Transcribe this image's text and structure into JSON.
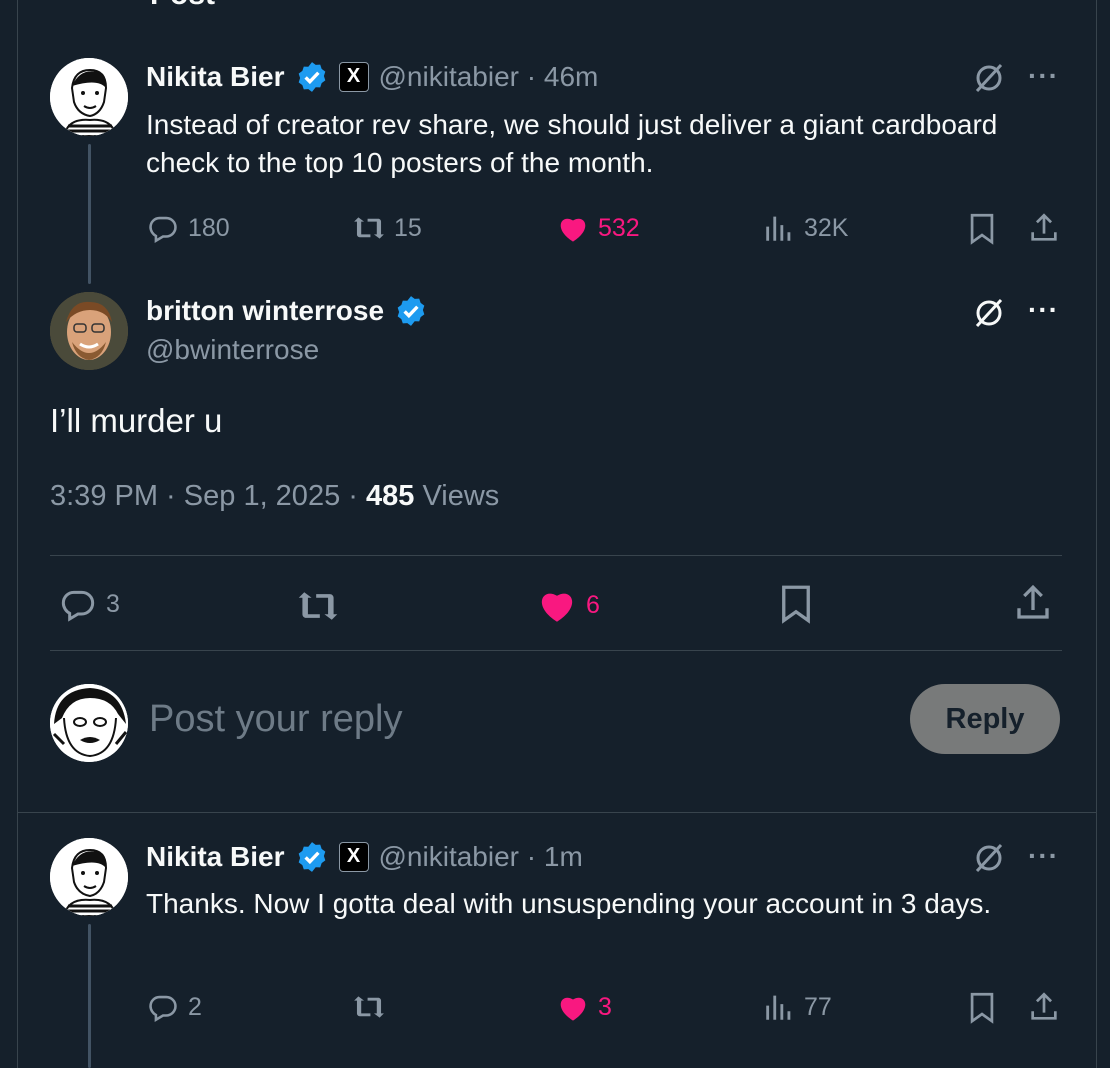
{
  "top_partial_text": "Post",
  "tweet1": {
    "name": "Nikita Bier",
    "handle": "@nikitabier",
    "time": "46m",
    "affiliate_badge": "X",
    "text": "Instead of creator rev share, we should just deliver a giant cardboard check to the top 10 posters of the month.",
    "replies": "180",
    "reposts": "15",
    "likes": "532",
    "views": "32K"
  },
  "main_tweet": {
    "name": "britton winterrose",
    "handle": "@bwinterrose",
    "text": "I’ll murder u",
    "time": "3:39 PM",
    "date": "Sep 1, 2025",
    "views_count": "485",
    "views_label": "Views",
    "replies": "3",
    "likes": "6"
  },
  "composer": {
    "placeholder": "Post your reply",
    "button": "Reply"
  },
  "tweet2": {
    "name": "Nikita Bier",
    "handle": "@nikitabier",
    "time": "1m",
    "affiliate_badge": "X",
    "text": "Thanks. Now I gotta deal with unsuspending your account in 3 days.",
    "replies": "2",
    "likes": "3",
    "views": "77"
  },
  "colors": {
    "background": "#15202b",
    "accent_blue": "#1d9bf0",
    "like_pink": "#f91880",
    "muted": "#8b98a5"
  }
}
